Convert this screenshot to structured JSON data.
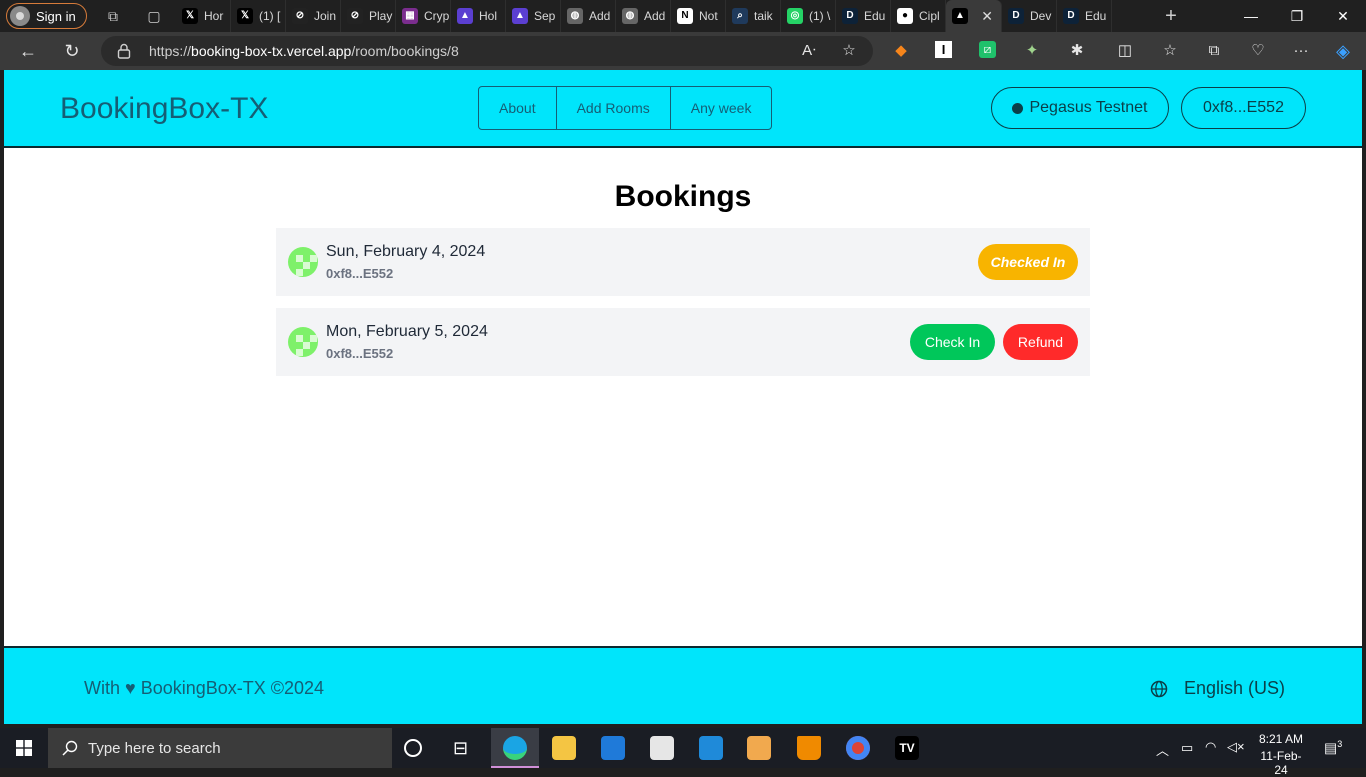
{
  "browser": {
    "sign_in": "Sign in",
    "tabs": [
      {
        "label": "Hor",
        "favicon": "x-icon",
        "color": "#000000"
      },
      {
        "label": "(1) [",
        "favicon": "x-icon",
        "color": "#000000"
      },
      {
        "label": "Join",
        "favicon": "slash-icon",
        "color": "#222222"
      },
      {
        "label": "Play",
        "favicon": "slash-icon",
        "color": "#222222"
      },
      {
        "label": "Cryp",
        "favicon": "grid-icon",
        "color": "#7b2d8e"
      },
      {
        "label": "Hol",
        "favicon": "triangle-icon",
        "color": "#5b3fd1"
      },
      {
        "label": "Sep",
        "favicon": "triangle-icon",
        "color": "#5b3fd1"
      },
      {
        "label": "Add",
        "favicon": "globe-icon",
        "color": "#666666"
      },
      {
        "label": "Add",
        "favicon": "globe-icon",
        "color": "#666666"
      },
      {
        "label": "Not",
        "favicon": "notion-icon",
        "color": "#ffffff"
      },
      {
        "label": "taik",
        "favicon": "search-icon",
        "color": "#1f3a5c"
      },
      {
        "label": "(1) \\",
        "favicon": "whatsapp-icon",
        "color": "#25d366"
      },
      {
        "label": "Edu",
        "favicon": "d-icon",
        "color": "#0d2238"
      },
      {
        "label": "Cipl",
        "favicon": "github-icon",
        "color": "#ffffff"
      },
      {
        "label": "",
        "favicon": "vercel-icon",
        "color": "#000000",
        "active": true
      },
      {
        "label": "Dev",
        "favicon": "d-icon",
        "color": "#0d2238"
      },
      {
        "label": "Edu",
        "favicon": "d-icon",
        "color": "#0d2238"
      }
    ],
    "url_prefix": "https://",
    "url_domain": "booking-box-tx.vercel.app",
    "url_path": "/room/bookings/8"
  },
  "header": {
    "brand": "BookingBox-TX",
    "nav": [
      "About",
      "Add Rooms",
      "Any week"
    ],
    "network": "Pegasus Testnet",
    "wallet": "0xf8...E552"
  },
  "main": {
    "title": "Bookings",
    "bookings": [
      {
        "date": "Sun, February 4, 2024",
        "address": "0xf8...E552",
        "status": "Checked In"
      },
      {
        "date": "Mon, February 5, 2024",
        "address": "0xf8...E552",
        "check_in": "Check In",
        "refund": "Refund"
      }
    ]
  },
  "footer": {
    "text": "With ♥ BookingBox-TX ©2024",
    "language": "English (US)"
  },
  "taskbar": {
    "search_placeholder": "Type here to search",
    "time": "8:21 AM",
    "date": "11-Feb-24",
    "notifications": "3"
  },
  "colors": {
    "header_bg": "#00e5fb",
    "checked_in": "#f8b400",
    "check_in": "#00c75a",
    "refund": "#ff2a2a"
  }
}
